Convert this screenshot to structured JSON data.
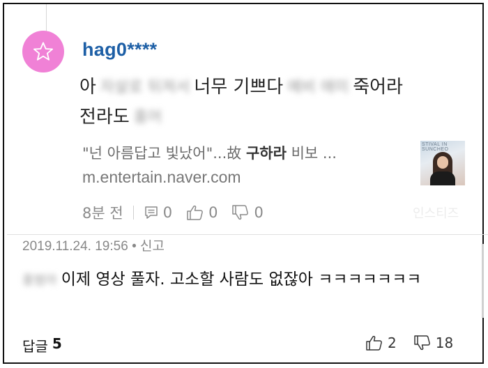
{
  "reply": {
    "username": "hag0****",
    "body_line1": {
      "prefix": "아",
      "blur1": "자살로 뒤져서",
      "middle": "너무 기쁘다",
      "blur2": "예비 애미",
      "suffix": "죽어라"
    },
    "body_line2": {
      "prefix": "전라도",
      "blur1": "홍어"
    },
    "link_preview": {
      "title_before": "\"넌 아름답고 빛났어\"...故 ",
      "title_bold": "구하라",
      "title_after": " 비보 ...",
      "url": "m.entertain.naver.com",
      "thumb_caption": "STIVAL IN SUNCHEO"
    },
    "meta": {
      "time": "8분 전",
      "replies": "0",
      "likes": "0",
      "dislikes": "0"
    },
    "watermark": "인스티즈"
  },
  "comment": {
    "partial_meta": "2019.11.24. 19:56 • 신고",
    "author_blur": "홍범아",
    "text": "이제 영상 풀자. 고소할 사람도 없잖아 ㅋㅋㅋㅋㅋㅋㅋ",
    "replies_label": "답글",
    "replies_count": "5",
    "likes": "2",
    "dislikes": "18"
  },
  "colors": {
    "avatar": "#f081d6",
    "username": "#1d5fa6"
  }
}
